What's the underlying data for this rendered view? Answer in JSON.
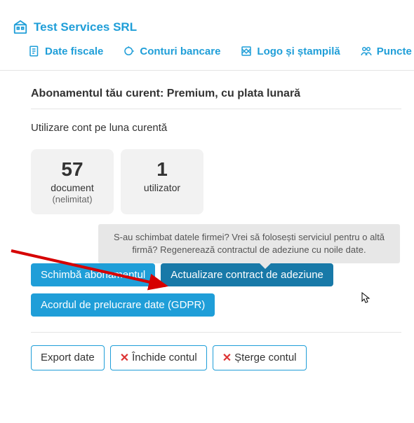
{
  "company": {
    "name": "Test Services SRL"
  },
  "tabs": [
    {
      "label": "Date fiscale"
    },
    {
      "label": "Conturi bancare"
    },
    {
      "label": "Logo și ștampilă"
    },
    {
      "label": "Puncte d"
    }
  ],
  "section": {
    "title": "Abonamentul tău curent: Premium, cu plata lunară",
    "usage_label": "Utilizare cont pe luna curentă"
  },
  "stats": [
    {
      "value": "57",
      "label": "document",
      "sub": "(nelimitat)"
    },
    {
      "value": "1",
      "label": "utilizator",
      "sub": ""
    }
  ],
  "tooltip": "S-au schimbat datele firmei? Vrei să folosești serviciul pentru o altă firmă? Regenerează contractul de adeziune cu noile date.",
  "buttons": {
    "change_plan": "Schimbă abonamentul",
    "update_contract": "Actualizare contract de adeziune",
    "gdpr": "Acordul de prelucrare date (GDPR)",
    "export": "Export date",
    "close_account": "Închide contul",
    "delete_account": "Șterge contul"
  },
  "colors": {
    "accent": "#1f9ed8",
    "danger": "#d33"
  }
}
